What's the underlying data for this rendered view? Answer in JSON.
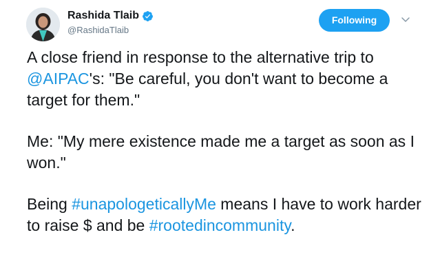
{
  "author": {
    "display_name": "Rashida Tlaib",
    "handle": "@RashidaTlaib",
    "verified": true
  },
  "follow_button": {
    "label": "Following"
  },
  "tweet": {
    "para1": {
      "before": "A close friend in response to the alternative trip to ",
      "mention": "@AIPAC",
      "after": "'s:  \"Be careful, you don't want to become a target for them.\""
    },
    "para2": {
      "text": "Me: \"My mere existence made me a target as soon as I won.\""
    },
    "para3": {
      "before": "Being ",
      "hashtag1": "#unapologeticallyMe",
      "middle": " means I have to work harder to raise $ and be ",
      "hashtag2": "#rootedincommunity",
      "after": "."
    }
  },
  "colors": {
    "accent": "#1da1f2",
    "link": "#1b95e0",
    "text": "#14171a",
    "secondary": "#657786"
  },
  "icons": {
    "verified": "verified-badge-icon",
    "more": "chevron-down-icon"
  }
}
